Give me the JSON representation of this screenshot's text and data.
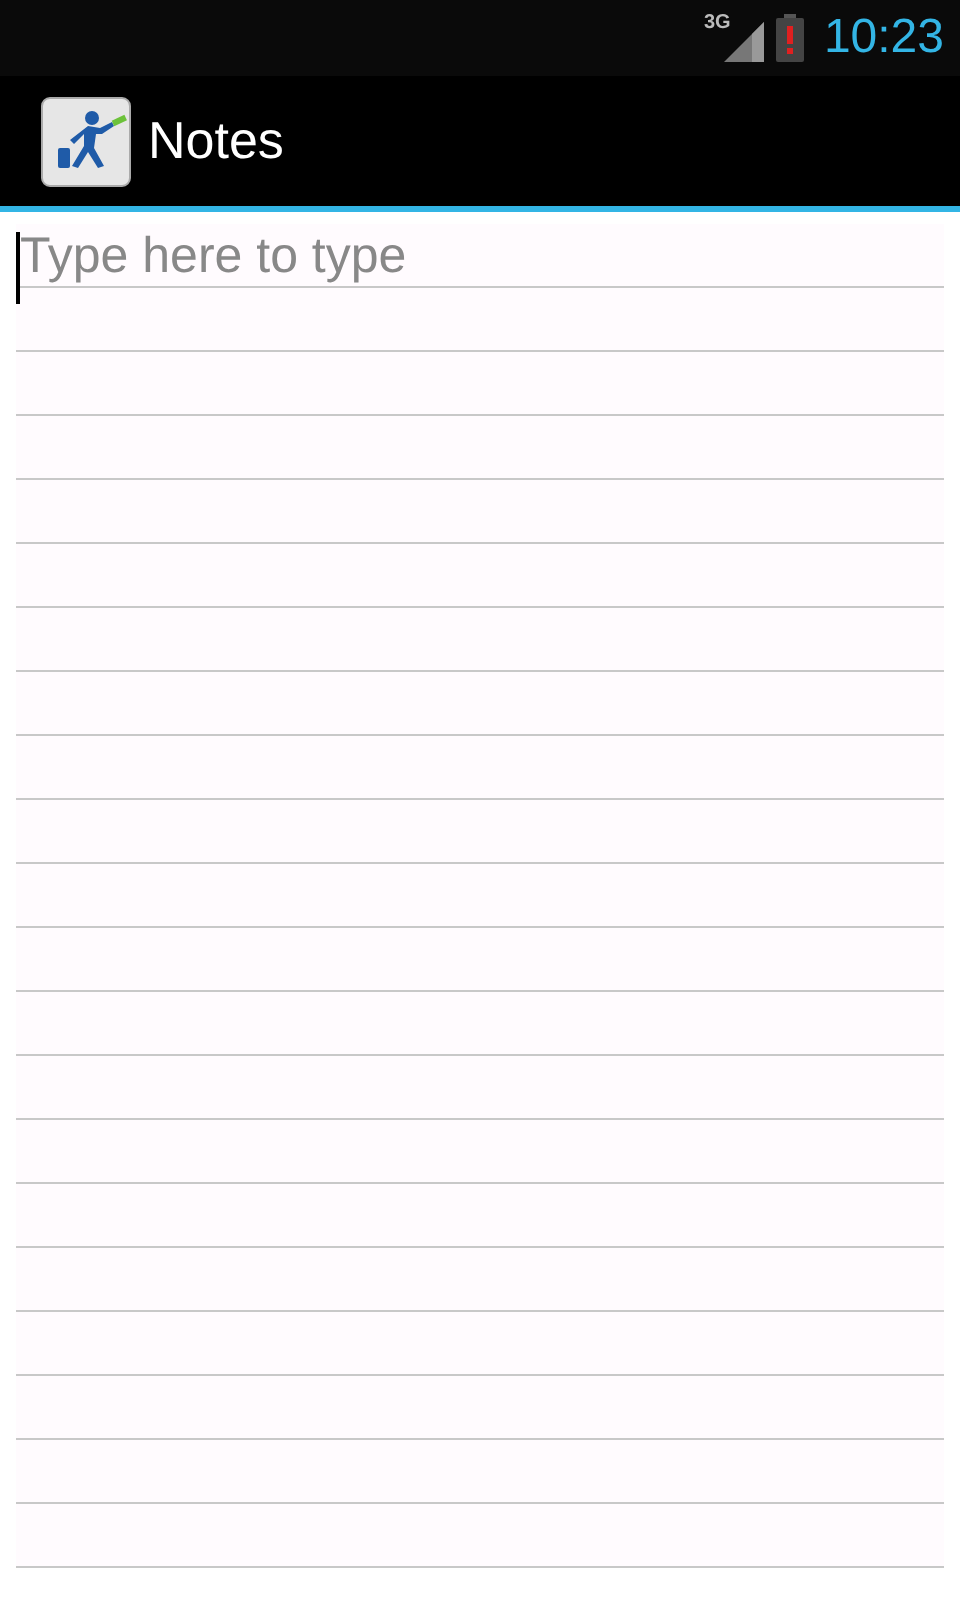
{
  "status_bar": {
    "network": "3G",
    "time": "10:23"
  },
  "action_bar": {
    "title": "Notes"
  },
  "note": {
    "placeholder": "Type here to type"
  }
}
